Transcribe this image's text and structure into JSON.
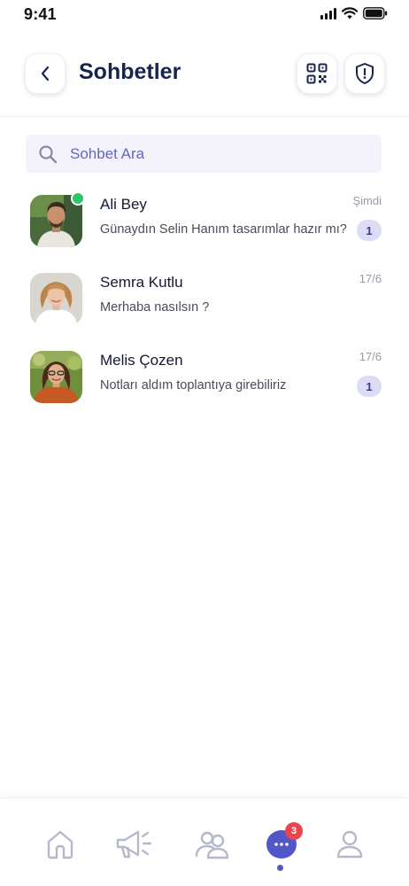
{
  "status_bar": {
    "time": "9:41",
    "icons": [
      "signal-icon",
      "wifi-icon",
      "battery-icon"
    ]
  },
  "header": {
    "title": "Sohbetler",
    "back_icon": "chevron-left-icon",
    "qr_icon": "qr-code-icon",
    "shield_icon": "shield-alert-icon"
  },
  "search": {
    "placeholder": "Sohbet Ara",
    "icon": "search-icon"
  },
  "chats": [
    {
      "name": "Ali Bey",
      "message": "Günaydın Selin Hanım tasarımlar hazır mı?",
      "time": "Şimdi",
      "unread": "1",
      "online": true
    },
    {
      "name": "Semra Kutlu",
      "message": "Merhaba nasılsın ?",
      "time": "17/6",
      "unread": "",
      "online": false
    },
    {
      "name": "Melis Çozen",
      "message": "Notları aldım toplantıya girebiliriz",
      "time": "17/6",
      "unread": "1",
      "online": false
    }
  ],
  "bottom_nav": {
    "items": [
      "home-icon",
      "megaphone-icon",
      "group-icon",
      "chat-icon",
      "profile-icon"
    ],
    "active": "chat-icon",
    "chat_badge": "3"
  },
  "colors": {
    "title": "#17244d",
    "accent": "#5156c9",
    "badge_red": "#e8474f",
    "online_green": "#2fc46a",
    "search_bg": "#f4f3fb",
    "unread_bg": "#dcdcf6"
  }
}
